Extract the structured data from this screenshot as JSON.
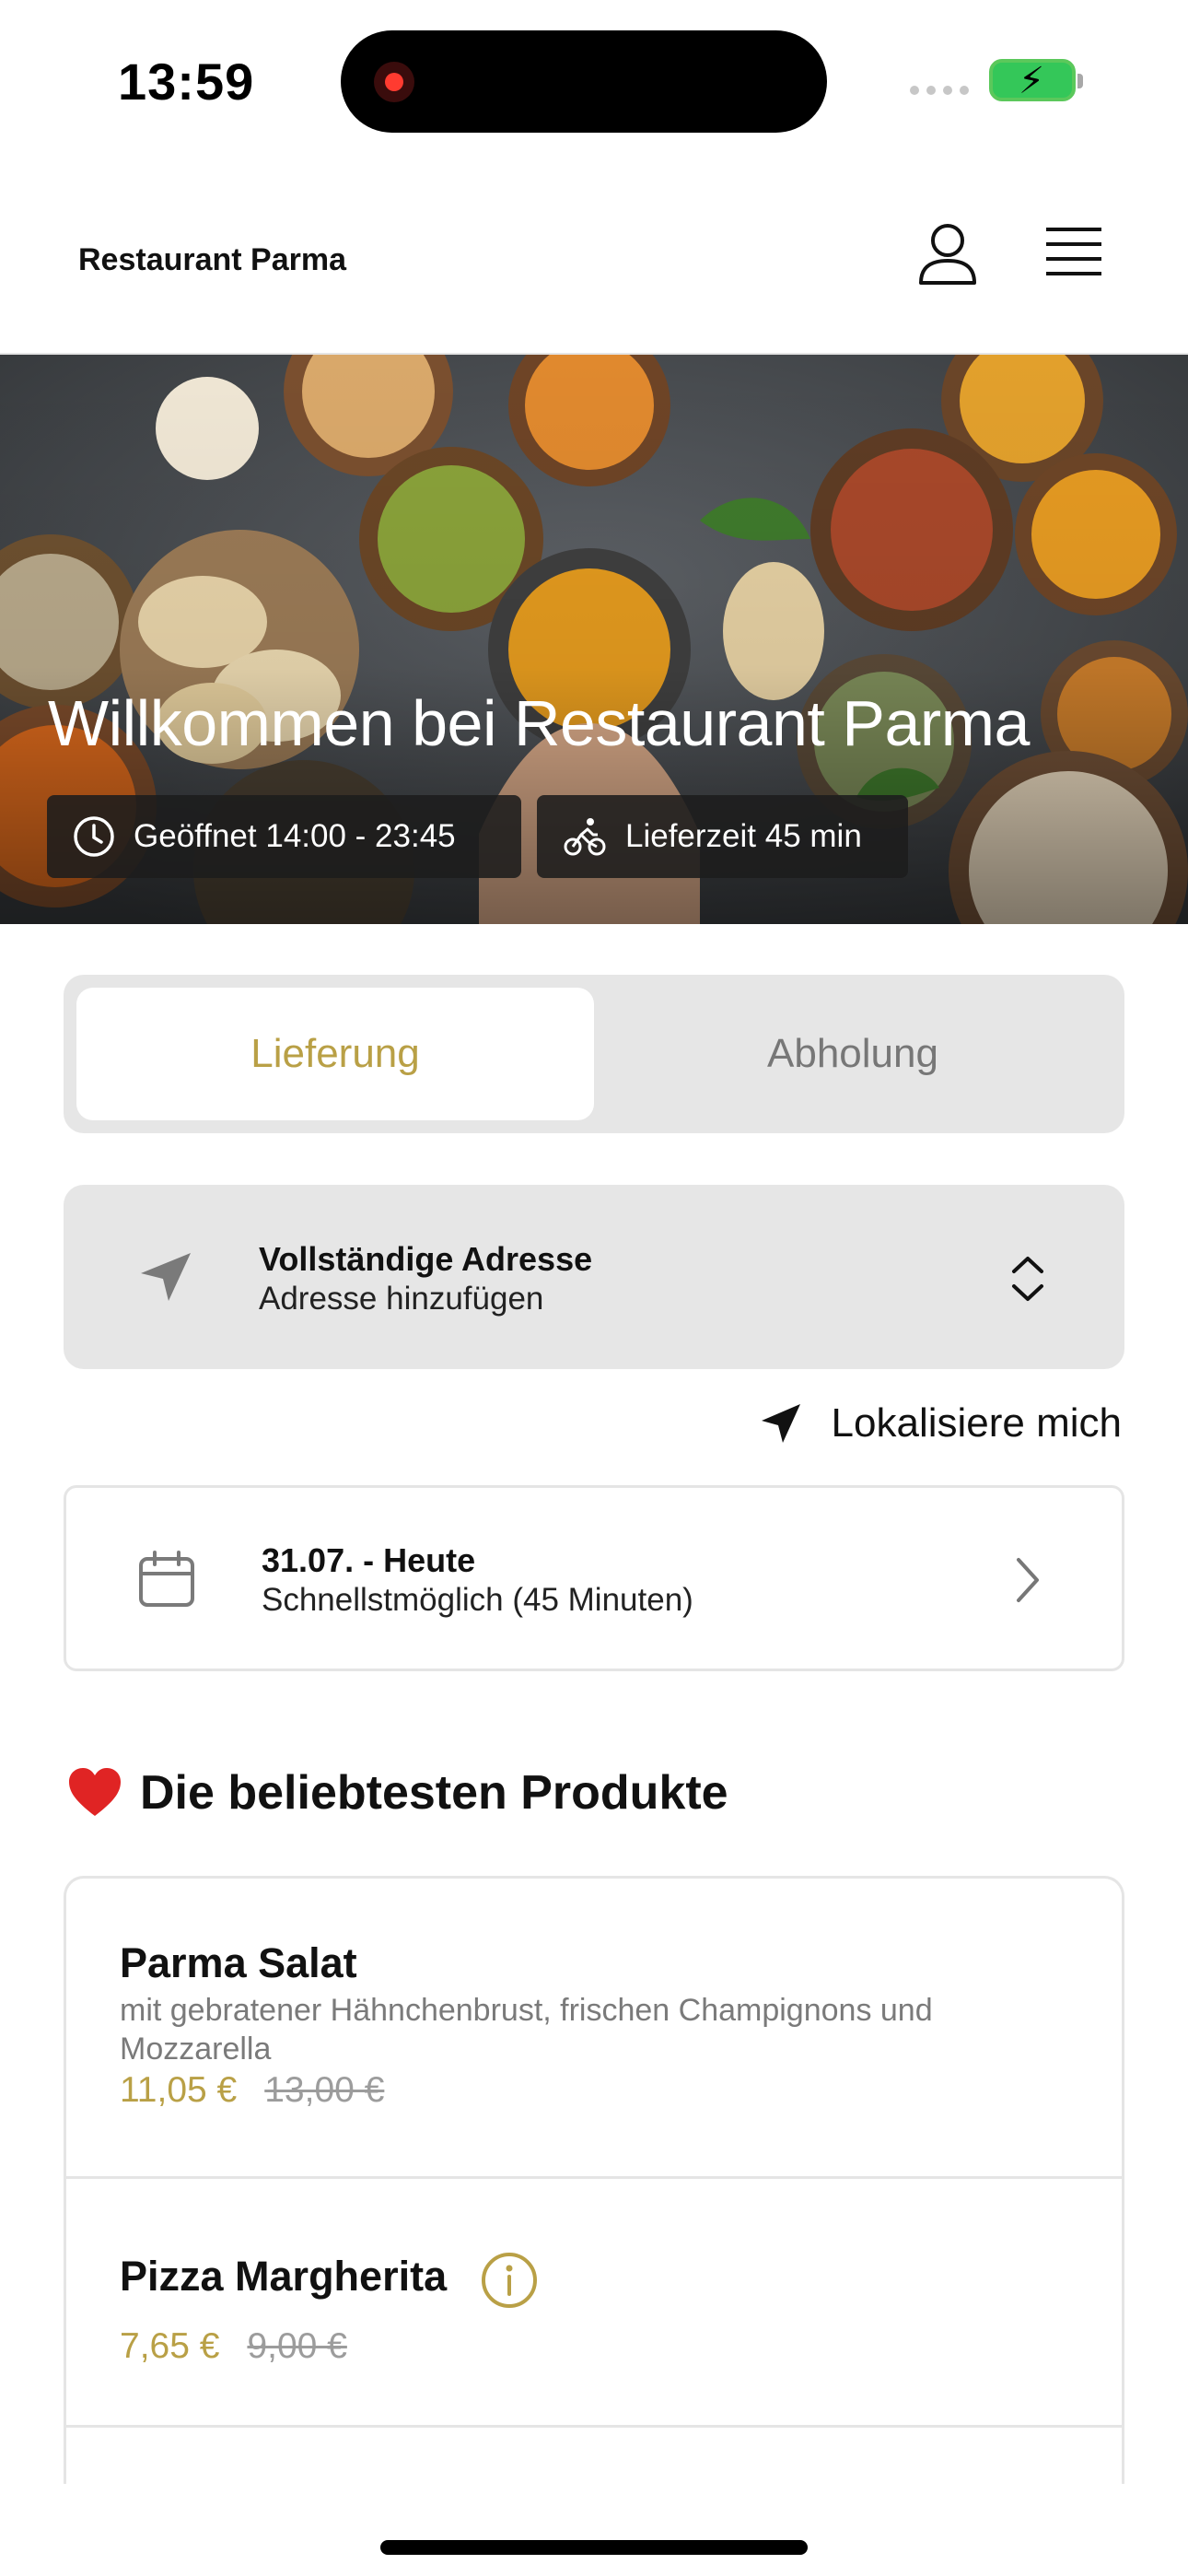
{
  "status_bar": {
    "time": "13:59"
  },
  "header": {
    "brand": "Restaurant Parma",
    "icons": [
      "user-icon",
      "menu-icon"
    ]
  },
  "hero": {
    "title": "Willkommen bei Restaurant Parma",
    "opening_hours": "Geöffnet 14:00 - 23:45",
    "delivery_time": "Lieferzeit 45 min",
    "icons": [
      "clock-icon",
      "bicycle-icon"
    ]
  },
  "tabs": [
    {
      "label": "Lieferung",
      "active": true
    },
    {
      "label": "Abholung",
      "active": false
    }
  ],
  "address": {
    "title": "Vollständige Adresse",
    "subtitle": "Adresse hinzufügen"
  },
  "locate": {
    "label": "Lokalisiere mich"
  },
  "date": {
    "title": "31.07. - Heute",
    "subtitle": "Schnellstmöglich (45 Minuten)"
  },
  "section": {
    "title": "Die beliebtesten Produkte"
  },
  "products": [
    {
      "name": "Parma Salat",
      "description": "mit gebratener Hähnchenbrust, frischen Champignons und Mozzarella",
      "price": "11,05 €",
      "old_price": "13,00 €"
    },
    {
      "name": "Pizza Margherita",
      "description": "",
      "price": "7,65 €",
      "old_price": "9,00 €"
    }
  ],
  "colors": {
    "accent": "#b9a046",
    "panel": "#e6e6e6",
    "border": "#e5e5e5",
    "battery": "#34c759",
    "heart": "#e02424"
  }
}
